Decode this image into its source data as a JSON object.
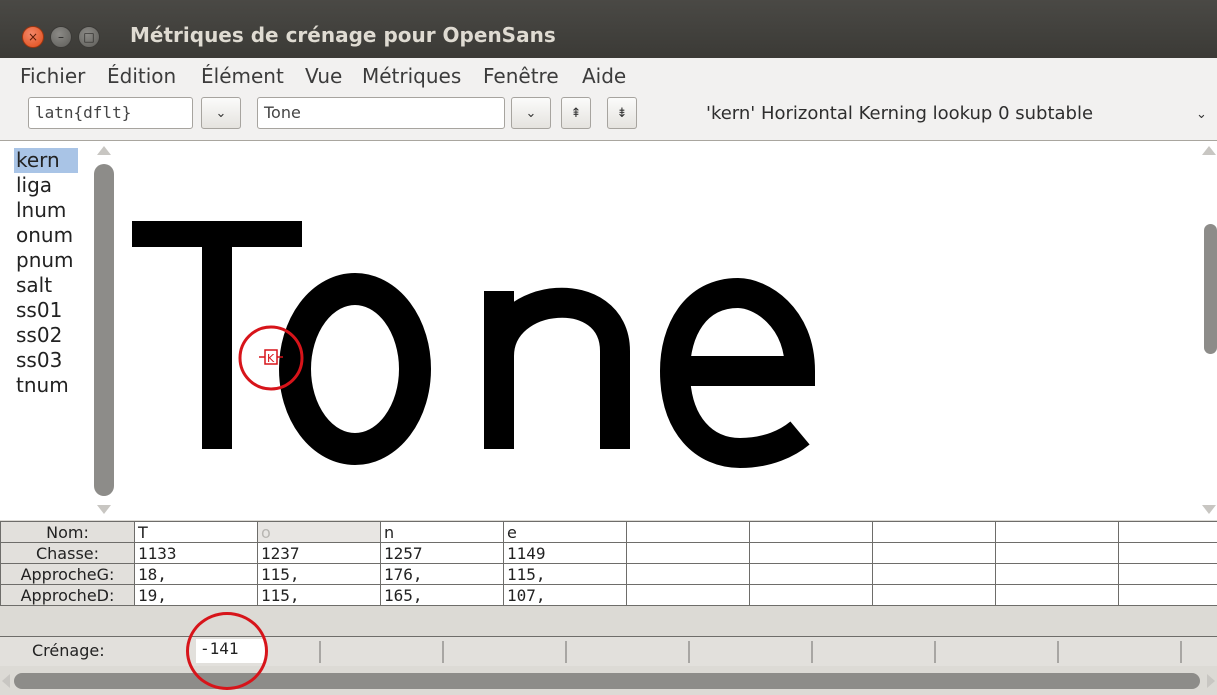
{
  "window": {
    "title": "Métriques de crénage pour OpenSans",
    "close_glyph": "×",
    "min_glyph": "–",
    "max_glyph": "□"
  },
  "menu": [
    "Fichier",
    "Édition",
    "Élément",
    "Vue",
    "Métriques",
    "Fenêtre",
    "Aide"
  ],
  "toolbar": {
    "script_value": "latn{dflt}",
    "text_value": "Tone",
    "dropdown_glyph": "⌄",
    "up_glyph": "⇞",
    "down_glyph": "⇟",
    "lookup_label": "'kern' Horizontal Kerning lookup 0 subtable",
    "lookup_arrow": "⌄"
  },
  "features": [
    "kern",
    "liga",
    "lnum",
    "onum",
    "pnum",
    "salt",
    "ss01",
    "ss02",
    "ss03",
    "tnum"
  ],
  "selected_feature": "kern",
  "preview": {
    "glyphs": [
      "T",
      "o",
      "n",
      "e"
    ],
    "marker_glyph": "K"
  },
  "metrics": {
    "labels": {
      "name": "Nom:",
      "advance": "Chasse:",
      "lsb": "ApprocheG:",
      "rsb": "ApprocheD:",
      "kern": "Crénage:"
    },
    "names": [
      "T",
      "o",
      "n",
      "e"
    ],
    "advances": [
      "1133",
      "1237",
      "1257",
      "1149"
    ],
    "lsb": [
      "18,",
      "115,",
      "176,",
      "115,"
    ],
    "rsb": [
      "19,",
      "115,",
      "165,",
      "107,"
    ],
    "kern_value": "-141"
  },
  "colors": {
    "highlight": "#d7141a",
    "selection": "#a9c4e6",
    "titlebar": "#3f3e3a"
  }
}
